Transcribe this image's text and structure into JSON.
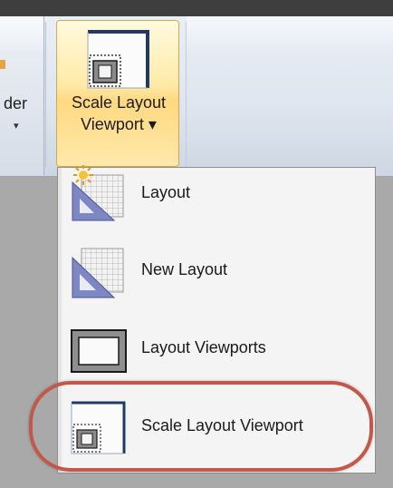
{
  "ribbon": {
    "left_partial_label": "der",
    "left_partial_arrow": "▾",
    "scale_button": {
      "label_line1": "Scale Layout",
      "label_line2": "Viewport ▾",
      "icon": "scale-viewport-icon"
    }
  },
  "menu": {
    "items": [
      {
        "label": "Layout",
        "icon": "layout-sun-icon"
      },
      {
        "label": "New Layout",
        "icon": "new-layout-icon"
      },
      {
        "label": "Layout Viewports",
        "icon": "layout-viewports-icon"
      },
      {
        "label": "Scale Layout Viewport",
        "icon": "scale-viewport-icon"
      }
    ]
  },
  "colors": {
    "highlight_ring": "#c2574a",
    "button_hover_top": "#fffae0",
    "button_hover_mid": "#ffd980",
    "icon_frame": "#1f3a66"
  }
}
